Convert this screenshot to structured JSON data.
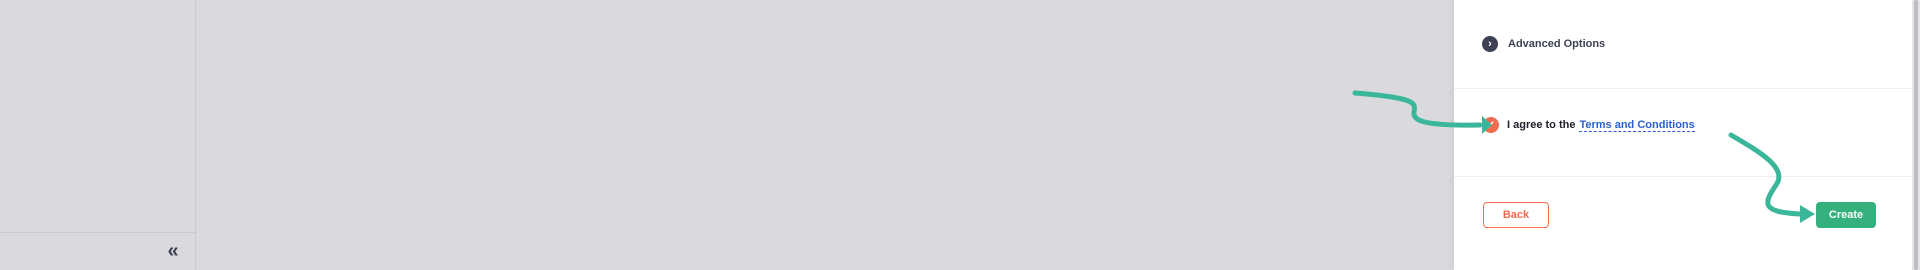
{
  "sidebar": {
    "collapse_icon": "double-chevron-left-icon",
    "collapse_glyph": "«"
  },
  "panel": {
    "advanced_options": {
      "icon": "chevron-right-circle-icon",
      "glyph": "›",
      "label": "Advanced Options"
    },
    "terms": {
      "checked": true,
      "check_glyph": "✓",
      "prefix": "I agree to the",
      "link_label": "Terms and Conditions"
    },
    "actions": {
      "back_label": "Back",
      "create_label": "Create"
    }
  },
  "colors": {
    "accent_orange": "#f06b4f",
    "create_green": "#33b07c",
    "link_blue": "#2c5fd6",
    "annotation_arrow": "#3ab79a",
    "dim_background": "#d9d9de"
  }
}
